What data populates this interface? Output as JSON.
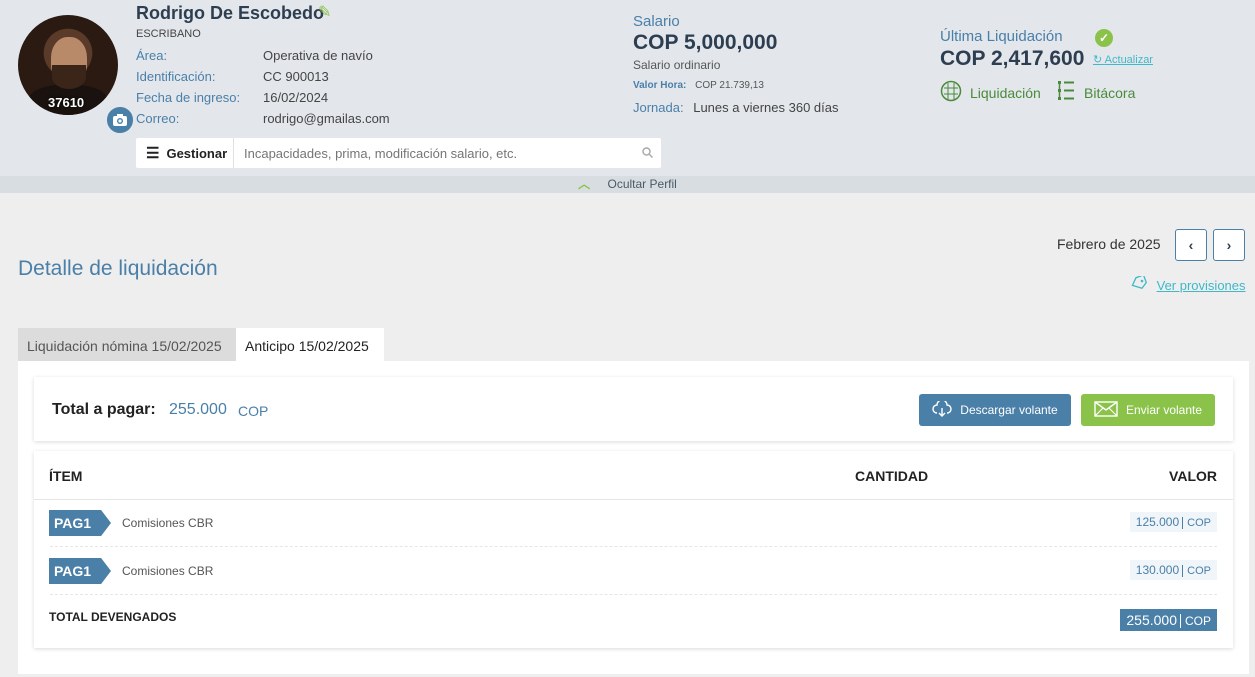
{
  "profile": {
    "avatar_number": "37610",
    "name": "Rodrigo De Escobedo",
    "role": "ESCRIBANO",
    "fields": [
      {
        "label": "Área:",
        "value": "Operativa de navío"
      },
      {
        "label": "Identificación:",
        "value": "CC 900013"
      },
      {
        "label": "Fecha de ingreso:",
        "value": "16/02/2024"
      },
      {
        "label": "Correo:",
        "value": "rodrigo@gmailas.com"
      }
    ],
    "gestionar_label": "Gestionar",
    "search_placeholder": "Incapacidades, prima, modificación salario, etc.",
    "ocultar_label": "Ocultar Perfil"
  },
  "salario": {
    "title": "Salario",
    "amount": "COP 5,000,000",
    "type": "Salario ordinario",
    "valor_hora_label": "Valor Hora:",
    "valor_hora_value": "COP 21.739,13",
    "jornada_label": "Jornada:",
    "jornada_value": "Lunes a viernes 360 días"
  },
  "ultima": {
    "title": "Última Liquidación",
    "amount": "COP 2,417,600",
    "actualizar": "Actualizar",
    "liquidacion_label": "Liquidación",
    "bitacora_label": "Bitácora"
  },
  "main": {
    "title": "Detalle de liquidación",
    "month": "Febrero de 2025",
    "provisiones": "Ver provisiones",
    "tabs": [
      {
        "label": "Liquidación nómina 15/02/2025"
      },
      {
        "label": "Anticipo 15/02/2025"
      }
    ],
    "total_label": "Total a pagar:",
    "total_value": "255.000",
    "total_currency": "COP",
    "descargar_label": "Descargar volante",
    "enviar_label": "Enviar volante",
    "columns": {
      "item": "ÍTEM",
      "cantidad": "CANTIDAD",
      "valor": "VALOR"
    },
    "rows": [
      {
        "tag": "PAG1",
        "desc": "Comisiones CBR",
        "value": "125.000",
        "currency": "COP"
      },
      {
        "tag": "PAG1",
        "desc": "Comisiones CBR",
        "value": "130.000",
        "currency": "COP"
      }
    ],
    "total_devengados_label": "TOTAL DEVENGADOS",
    "total_devengados_value": "255.000",
    "total_devengados_currency": "COP"
  },
  "colors": {
    "primary": "#4a7fa8",
    "accent_green": "#8bc34a",
    "link": "#3fb8c8"
  }
}
